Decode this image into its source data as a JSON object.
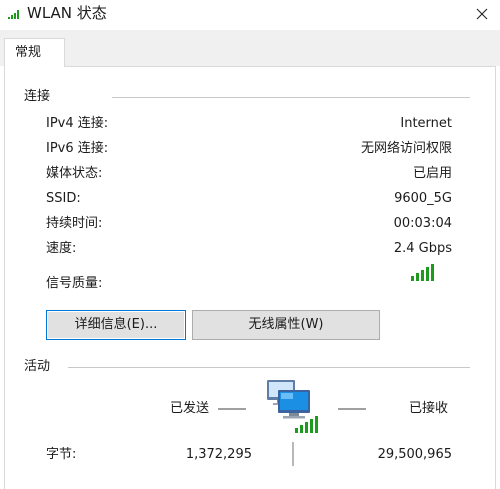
{
  "window": {
    "title": "WLAN 状态",
    "close_icon": "close-icon"
  },
  "tabs": [
    {
      "label": "常规",
      "active": true
    }
  ],
  "connection": {
    "group_label": "连接",
    "rows": [
      {
        "label": "IPv4 连接:",
        "value": "Internet"
      },
      {
        "label": "IPv6 连接:",
        "value": "无网络访问权限"
      },
      {
        "label": "媒体状态:",
        "value": "已启用"
      },
      {
        "label": "SSID:",
        "value": "9600_5G"
      },
      {
        "label": "持续时间:",
        "value": "00:03:04"
      },
      {
        "label": "速度:",
        "value": "2.4 Gbps"
      }
    ],
    "signal_label": "信号质量:",
    "signal_bars_active": 5,
    "signal_bars_total": 5,
    "signal_icon": "signal-bars-icon",
    "details_button": "详细信息(E)...",
    "wireless_props_button": "无线属性(W)"
  },
  "activity": {
    "group_label": "活动",
    "sent_label": "已发送",
    "received_label": "已接收",
    "bytes_label": "字节:",
    "bytes_sent": "1,372,295",
    "bytes_received": "29,500,965",
    "network_icon": "network-computers-icon"
  },
  "colors": {
    "signal_green": "#1e9b1e",
    "focus_blue": "#0078d7",
    "button_face": "#e1e1e1",
    "tab_strip": "#f0f0f0"
  }
}
